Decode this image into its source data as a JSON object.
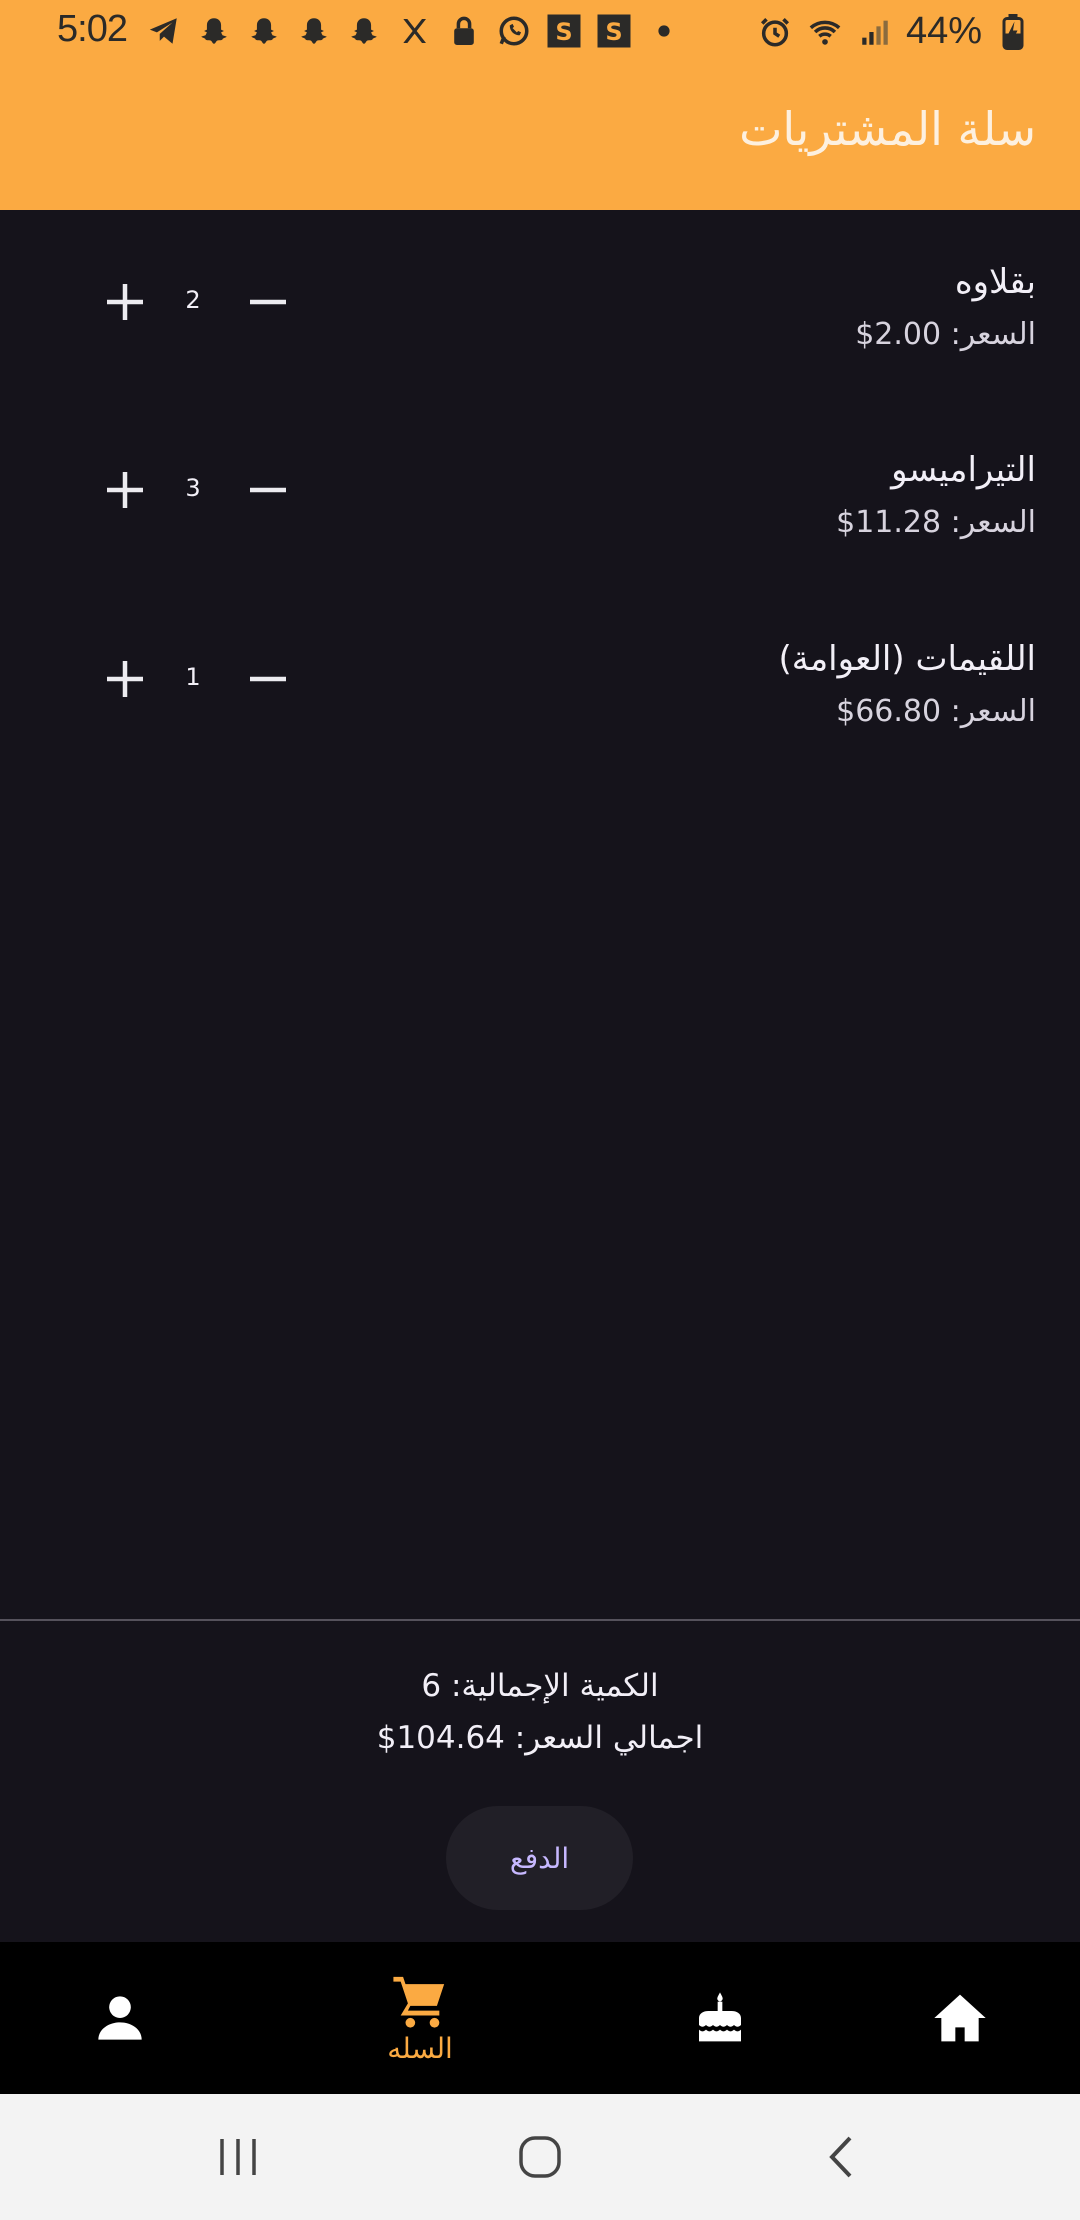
{
  "status_bar": {
    "time": "5:02",
    "battery": "44%",
    "icons_left": [
      "telegram-icon",
      "snapchat-icon",
      "snapchat-icon",
      "snapchat-icon",
      "snapchat-icon",
      "x-icon",
      "lock-icon",
      "whatsapp-icon",
      "s-app-icon",
      "s-app-icon",
      "dot-icon"
    ],
    "icons_right": [
      "alarm-icon",
      "wifi-icon",
      "signal-icon",
      "battery-charging-icon"
    ]
  },
  "app_bar": {
    "title": "سلة المشتريات"
  },
  "cart": {
    "items": [
      {
        "name": "بقلاوه",
        "price_text": "السعر: 2.00$",
        "qty": "2"
      },
      {
        "name": "التيراميسو",
        "price_text": "السعر: 11.28$",
        "qty": "3"
      },
      {
        "name": "اللقيمات (العوامة)",
        "price_text": "السعر: 66.80$",
        "qty": "1"
      }
    ]
  },
  "summary": {
    "total_qty_text": "الكمية الإجمالية: 6",
    "total_price_text": "اجمالي السعر: 104.64$",
    "pay_label": "الدفع"
  },
  "bottom_nav": {
    "items": [
      {
        "icon": "person-icon",
        "label": ""
      },
      {
        "icon": "cart-icon",
        "label": "السله",
        "active": true
      },
      {
        "icon": "cake-icon",
        "label": ""
      },
      {
        "icon": "home-icon",
        "label": ""
      }
    ]
  },
  "colors": {
    "primary": "#fbaa42",
    "background": "#15131b",
    "button_text": "#c7b8ff"
  }
}
